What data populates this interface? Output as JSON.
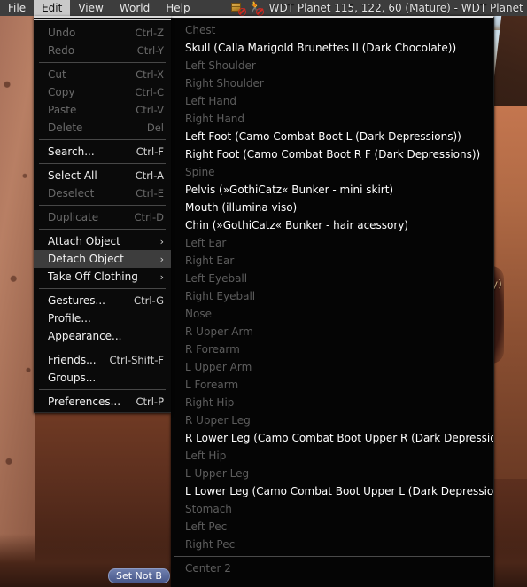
{
  "window": {
    "title": "WDT Planet 115, 122, 60 (Mature) - WDT Planet (Albus Cimino",
    "icons": [
      "box-blocked-icon",
      "run-blocked-icon"
    ]
  },
  "menubar": {
    "items": [
      {
        "label": "File",
        "active": false
      },
      {
        "label": "Edit",
        "active": true
      },
      {
        "label": "View",
        "active": false
      },
      {
        "label": "World",
        "active": false
      },
      {
        "label": "Help",
        "active": false
      }
    ]
  },
  "edit_menu": {
    "groups": [
      [
        {
          "label": "Undo",
          "accel": "Ctrl-Z",
          "disabled": true
        },
        {
          "label": "Redo",
          "accel": "Ctrl-Y",
          "disabled": true
        }
      ],
      [
        {
          "label": "Cut",
          "accel": "Ctrl-X",
          "disabled": true
        },
        {
          "label": "Copy",
          "accel": "Ctrl-C",
          "disabled": true
        },
        {
          "label": "Paste",
          "accel": "Ctrl-V",
          "disabled": true
        },
        {
          "label": "Delete",
          "accel": "Del",
          "disabled": true
        }
      ],
      [
        {
          "label": "Search...",
          "accel": "Ctrl-F",
          "disabled": false
        }
      ],
      [
        {
          "label": "Select All",
          "accel": "Ctrl-A",
          "disabled": false
        },
        {
          "label": "Deselect",
          "accel": "Ctrl-E",
          "disabled": true
        }
      ],
      [
        {
          "label": "Duplicate",
          "accel": "Ctrl-D",
          "disabled": true
        }
      ],
      [
        {
          "label": "Attach Object",
          "accel": "",
          "disabled": false,
          "submenu": true
        },
        {
          "label": "Detach Object",
          "accel": "",
          "disabled": false,
          "submenu": true,
          "highlighted": true
        },
        {
          "label": "Take Off Clothing",
          "accel": "",
          "disabled": false,
          "submenu": true
        }
      ],
      [
        {
          "label": "Gestures...",
          "accel": "Ctrl-G",
          "disabled": false
        },
        {
          "label": "Profile...",
          "accel": "",
          "disabled": false
        },
        {
          "label": "Appearance...",
          "accel": "",
          "disabled": false
        }
      ],
      [
        {
          "label": "Friends...",
          "accel": "Ctrl-Shift-F",
          "disabled": false
        },
        {
          "label": "Groups...",
          "accel": "",
          "disabled": false
        }
      ],
      [
        {
          "label": "Preferences...",
          "accel": "Ctrl-P",
          "disabled": false
        }
      ]
    ]
  },
  "detach_submenu": {
    "groups": [
      [
        {
          "label": "Chest",
          "attached": false
        },
        {
          "label": "Skull (Calla Marigold Brunettes II (Dark Chocolate))",
          "attached": true
        },
        {
          "label": "Left Shoulder",
          "attached": false
        },
        {
          "label": "Right Shoulder",
          "attached": false
        },
        {
          "label": "Left Hand",
          "attached": false
        },
        {
          "label": "Right Hand",
          "attached": false
        },
        {
          "label": "Left Foot (Camo Combat Boot L (Dark Depressions))",
          "attached": true
        },
        {
          "label": "Right Foot (Camo Combat Boot R F (Dark Depressions))",
          "attached": true
        },
        {
          "label": "Spine",
          "attached": false
        },
        {
          "label": "Pelvis (»GothiCatz« Bunker - mini skirt)",
          "attached": true
        },
        {
          "label": "Mouth (illumina viso)",
          "attached": true
        },
        {
          "label": "Chin (»GothiCatz« Bunker - hair acessory)",
          "attached": true
        },
        {
          "label": "Left Ear",
          "attached": false
        },
        {
          "label": "Right Ear",
          "attached": false
        },
        {
          "label": "Left Eyeball",
          "attached": false
        },
        {
          "label": "Right Eyeball",
          "attached": false
        },
        {
          "label": "Nose",
          "attached": false
        },
        {
          "label": "R Upper Arm",
          "attached": false
        },
        {
          "label": "R Forearm",
          "attached": false
        },
        {
          "label": "L Upper Arm",
          "attached": false
        },
        {
          "label": "L Forearm",
          "attached": false
        },
        {
          "label": "Right Hip",
          "attached": false
        },
        {
          "label": "R Upper Leg",
          "attached": false
        },
        {
          "label": "R Lower Leg (Camo Combat Boot Upper R (Dark Depressions))",
          "attached": true
        },
        {
          "label": "Left Hip",
          "attached": false
        },
        {
          "label": "L Upper Leg",
          "attached": false
        },
        {
          "label": "L Lower Leg (Camo Combat Boot Upper L (Dark Depressions))",
          "attached": true
        },
        {
          "label": "Stomach",
          "attached": false
        },
        {
          "label": "Left Pec",
          "attached": false
        },
        {
          "label": "Right Pec",
          "attached": false
        }
      ],
      [
        {
          "label": "Center 2",
          "attached": false
        }
      ]
    ]
  },
  "bottom_bar": {
    "set_not_busy_label": "Set Not B"
  },
  "background": {
    "floating_label": "sy)"
  },
  "colors": {
    "menubar_bg": "#3d3d3d",
    "menu_bg": "#0a0a0a",
    "highlight_bg": "#3d3d3d",
    "text": "#ffffff",
    "disabled_text": "#5d5d5d",
    "button_blue": "#5b6b9c"
  }
}
